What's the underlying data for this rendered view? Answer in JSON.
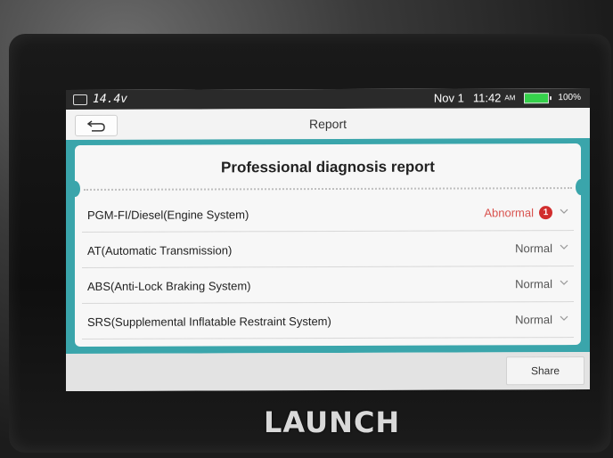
{
  "status_bar": {
    "voltage": "14.4v",
    "date": "Nov 1",
    "time": "11:42",
    "ampm": "AM",
    "battery": "100%",
    "battery_color": "#35d24b"
  },
  "header": {
    "title": "Report",
    "back_icon": "back-arrow-icon"
  },
  "report": {
    "heading": "Professional diagnosis report",
    "rows": [
      {
        "name": "PGM-FI/Diesel(Engine System)",
        "status": "Abnormal",
        "badge": "1"
      },
      {
        "name": "AT(Automatic Transmission)",
        "status": "Normal"
      },
      {
        "name": "ABS(Anti-Lock Braking System)",
        "status": "Normal"
      },
      {
        "name": "SRS(Supplemental Inflatable Restraint System)",
        "status": "Normal"
      }
    ],
    "accent_color": "#3aa5ab",
    "abnormal_color": "#d9534f"
  },
  "footer": {
    "share_label": "Share"
  },
  "device": {
    "brand": "LAUNCH"
  }
}
